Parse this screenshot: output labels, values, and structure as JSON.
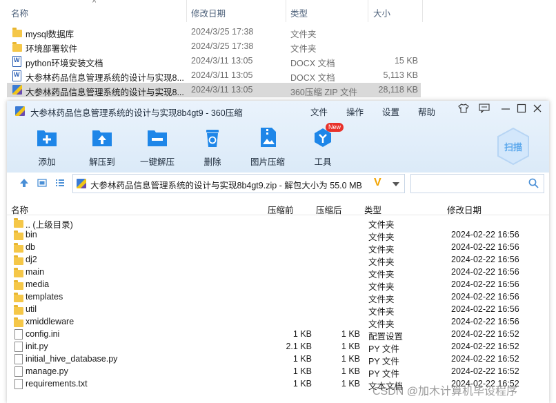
{
  "explorer": {
    "headers": {
      "name": "名称",
      "modified": "修改日期",
      "type": "类型",
      "size": "大小"
    },
    "rows": [
      {
        "icon": "folder-icon",
        "name": "mysql数据库",
        "date": "2024/3/25 17:38",
        "type": "文件夹",
        "size": ""
      },
      {
        "icon": "folder-icon",
        "name": "环境部署软件",
        "date": "2024/3/25 17:38",
        "type": "文件夹",
        "size": ""
      },
      {
        "icon": "docx-icon",
        "name": "python环境安装文档",
        "date": "2024/3/11 13:05",
        "type": "DOCX 文档",
        "size": "15 KB"
      },
      {
        "icon": "docx-icon",
        "name": "大参林药品信息管理系统的设计与实现8...",
        "date": "2024/3/11 13:05",
        "type": "DOCX 文档",
        "size": "5,113 KB"
      },
      {
        "icon": "zip-icon",
        "name": "大参林药品信息管理系统的设计与实现8...",
        "date": "2024/3/11 13:05",
        "type": "360压缩 ZIP 文件",
        "size": "28,118 KB",
        "selected": true
      }
    ]
  },
  "zipwin": {
    "title": "大参林药品信息管理系统的设计与实现8b4gt9 - 360压缩",
    "menu": [
      "文件",
      "操作",
      "设置",
      "帮助"
    ],
    "tools": [
      {
        "label": "添加",
        "icon": "add-icon"
      },
      {
        "label": "解压到",
        "icon": "extract-to-icon"
      },
      {
        "label": "一键解压",
        "icon": "one-click-extract-icon"
      },
      {
        "label": "删除",
        "icon": "delete-icon"
      },
      {
        "label": "图片压缩",
        "icon": "image-compress-icon"
      },
      {
        "label": "工具",
        "icon": "tools-icon",
        "badge": "New"
      }
    ],
    "scan_label": "扫描",
    "address": "大参林药品信息管理系统的设计与实现8b4gt9.zip - 解包大小为 55.0 MB",
    "columns": {
      "name": "名称",
      "before": "压缩前",
      "after": "压缩后",
      "type": "类型",
      "modified": "修改日期"
    },
    "files": [
      {
        "icon": "folder-icon",
        "name": ".. (上级目录)",
        "before": "",
        "after": "",
        "type": "文件夹",
        "modified": ""
      },
      {
        "icon": "folder-icon",
        "name": "bin",
        "before": "",
        "after": "",
        "type": "文件夹",
        "modified": "2024-02-22 16:56"
      },
      {
        "icon": "folder-icon",
        "name": "db",
        "before": "",
        "after": "",
        "type": "文件夹",
        "modified": "2024-02-22 16:56"
      },
      {
        "icon": "folder-icon",
        "name": "dj2",
        "before": "",
        "after": "",
        "type": "文件夹",
        "modified": "2024-02-22 16:56"
      },
      {
        "icon": "folder-icon",
        "name": "main",
        "before": "",
        "after": "",
        "type": "文件夹",
        "modified": "2024-02-22 16:56"
      },
      {
        "icon": "folder-icon",
        "name": "media",
        "before": "",
        "after": "",
        "type": "文件夹",
        "modified": "2024-02-22 16:56"
      },
      {
        "icon": "folder-icon",
        "name": "templates",
        "before": "",
        "after": "",
        "type": "文件夹",
        "modified": "2024-02-22 16:56"
      },
      {
        "icon": "folder-icon",
        "name": "util",
        "before": "",
        "after": "",
        "type": "文件夹",
        "modified": "2024-02-22 16:56"
      },
      {
        "icon": "folder-icon",
        "name": "xmiddleware",
        "before": "",
        "after": "",
        "type": "文件夹",
        "modified": "2024-02-22 16:56"
      },
      {
        "icon": "config-file-icon",
        "name": "config.ini",
        "before": "1 KB",
        "after": "1 KB",
        "type": "配置设置",
        "modified": "2024-02-22 16:52"
      },
      {
        "icon": "file-icon",
        "name": "init.py",
        "before": "2.1 KB",
        "after": "1 KB",
        "type": "PY 文件",
        "modified": "2024-02-22 16:52"
      },
      {
        "icon": "file-icon",
        "name": "initial_hive_database.py",
        "before": "1 KB",
        "after": "1 KB",
        "type": "PY 文件",
        "modified": "2024-02-22 16:52"
      },
      {
        "icon": "file-icon",
        "name": "manage.py",
        "before": "1 KB",
        "after": "1 KB",
        "type": "PY 文件",
        "modified": "2024-02-22 16:52"
      },
      {
        "icon": "file-icon",
        "name": "requirements.txt",
        "before": "1 KB",
        "after": "1 KB",
        "type": "文本文档",
        "modified": "2024-02-22 16:52"
      }
    ]
  },
  "watermark": "CSDN @加木计算机毕设程序",
  "colors": {
    "accent": "#1e86e8",
    "badge": "#e8322b",
    "selected_row": "#d9d9d9"
  }
}
